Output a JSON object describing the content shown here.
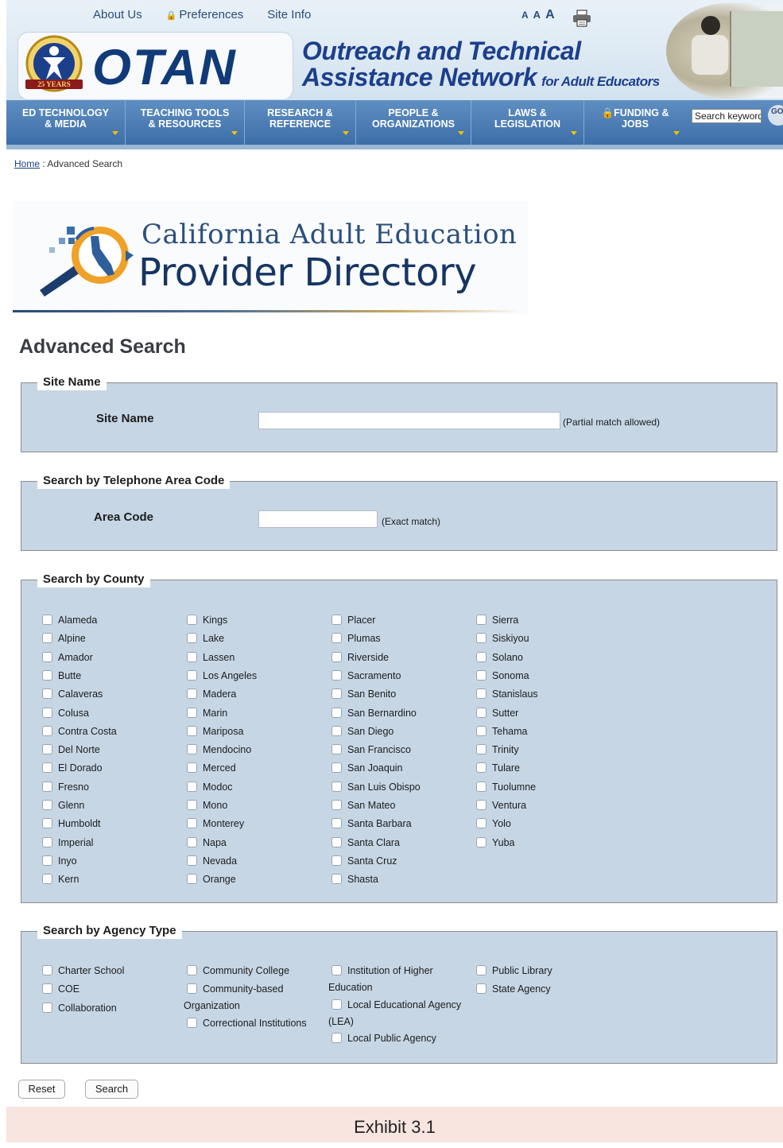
{
  "header": {
    "top_links": [
      "About Us",
      "Preferences",
      "Site Info"
    ],
    "font_size_links": [
      "A",
      "A",
      "A"
    ],
    "logo_text": "OTAN",
    "badge_text": "25 YEARS",
    "tagline_line1": "Outreach and Technical",
    "tagline_line2": "Assistance Network",
    "tagline_small": "for Adult Educators",
    "nav": [
      {
        "line1": "ED TECHNOLOGY",
        "line2": "& MEDIA"
      },
      {
        "line1": "TEACHING TOOLS",
        "line2": "& RESOURCES"
      },
      {
        "line1": "RESEARCH &",
        "line2": "REFERENCE"
      },
      {
        "line1": "PEOPLE &",
        "line2": "ORGANIZATIONS"
      },
      {
        "line1": "LAWS &",
        "line2": "LEGISLATION"
      },
      {
        "line1": "FUNDING &",
        "line2": "JOBS"
      }
    ],
    "search_value": "Search keyword",
    "go_label": "GO"
  },
  "breadcrumb": {
    "home": "Home",
    "separator": " : ",
    "current": "Advanced Search"
  },
  "banner": {
    "line1": "California Adult Education",
    "line2": "Provider Directory"
  },
  "page_title": "Advanced Search",
  "site_name_section": {
    "legend": "Site Name",
    "label": "Site Name",
    "value": "",
    "hint": "(Partial match allowed)"
  },
  "area_code_section": {
    "legend": "Search by Telephone Area Code",
    "label": "Area Code",
    "value": "",
    "hint": "(Exact match)"
  },
  "county_section": {
    "legend": "Search by County",
    "columns": [
      [
        "Alameda",
        "Alpine",
        "Amador",
        "Butte",
        "Calaveras",
        "Colusa",
        "Contra Costa",
        "Del Norte",
        "El Dorado",
        "Fresno",
        "Glenn",
        "Humboldt",
        "Imperial",
        "Inyo",
        "Kern"
      ],
      [
        "Kings",
        "Lake",
        "Lassen",
        "Los Angeles",
        "Madera",
        "Marin",
        "Mariposa",
        "Mendocino",
        "Merced",
        "Modoc",
        "Mono",
        "Monterey",
        "Napa",
        "Nevada",
        "Orange"
      ],
      [
        "Placer",
        "Plumas",
        "Riverside",
        "Sacramento",
        "San Benito",
        "San Bernardino",
        "San Diego",
        "San Francisco",
        "San Joaquin",
        "San Luis Obispo",
        "San Mateo",
        "Santa Barbara",
        "Santa Clara",
        "Santa Cruz",
        "Shasta"
      ],
      [
        "Sierra",
        "Siskiyou",
        "Solano",
        "Sonoma",
        "Stanislaus",
        "Sutter",
        "Tehama",
        "Trinity",
        "Tulare",
        "Tuolumne",
        "Ventura",
        "Yolo",
        "Yuba"
      ]
    ]
  },
  "agency_section": {
    "legend": "Search by Agency Type",
    "col1": [
      "Charter School",
      "COE",
      "Collaboration"
    ],
    "col2": {
      "community_college": "Community College",
      "community_based_1": "Community-based",
      "community_based_2": "Organization",
      "correctional": "Correctional Institutions"
    },
    "col3": {
      "higher_ed_1": "Institution of Higher",
      "higher_ed_2": "Education",
      "lea_1": "Local Educational Agency",
      "lea_2": "(LEA)",
      "local_public": "Local Public Agency"
    },
    "col4": [
      "Public Library",
      "State Agency"
    ]
  },
  "buttons": {
    "reset": "Reset",
    "search": "Search"
  },
  "caption": "Exhibit 3.1"
}
